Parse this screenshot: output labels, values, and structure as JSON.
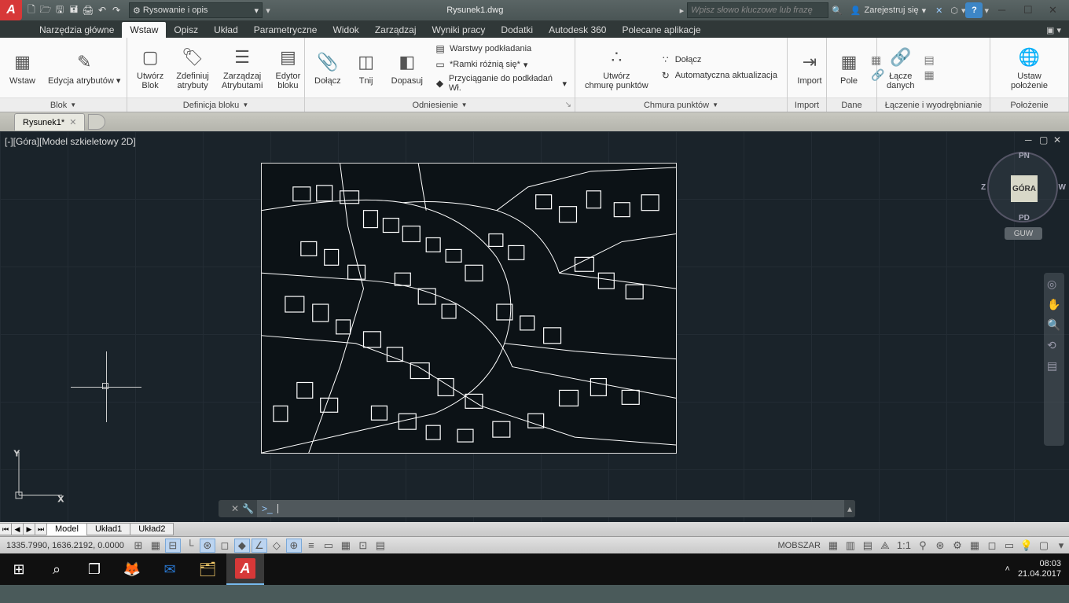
{
  "title": "Rysunek1.dwg",
  "workspace": "Rysowanie i opis",
  "search_placeholder": "Wpisz słowo kluczowe lub frazę",
  "signin": "Zarejestruj się",
  "tabs": [
    "Narzędzia główne",
    "Wstaw",
    "Opisz",
    "Układ",
    "Parametryczne",
    "Widok",
    "Zarządzaj",
    "Wyniki pracy",
    "Dodatki",
    "Autodesk 360",
    "Polecane aplikacje"
  ],
  "active_tab": 1,
  "panels": {
    "blok": {
      "title": "Blok",
      "btns": {
        "wstaw": "Wstaw",
        "edycja": "Edycja atrybutów"
      }
    },
    "defblok": {
      "title": "Definicja bloku",
      "btns": {
        "utworz": "Utwórz\nBlok",
        "zdef": "Zdefiniuj\natrybuty",
        "zarz": "Zarządzaj\nAtrybutami",
        "edytor": "Edytor\nbloku"
      }
    },
    "odniesienie": {
      "title": "Odniesienie",
      "btns": {
        "dolacz": "Dołącz",
        "tnij": "Tnij",
        "dopasuj": "Dopasuj"
      },
      "rows": {
        "warstwy": "Warstwy podkładania",
        "ramki": "*Ramki różnią się*",
        "przyc": "Przyciąganie do podkładań Wł."
      }
    },
    "chmura": {
      "title": "Chmura punktów",
      "btn": "Utwórz\nchmurę punktów",
      "rows": {
        "dolacz": "Dołącz",
        "auto": "Automatyczna aktualizacja"
      }
    },
    "import": {
      "title": "Import",
      "btn": "Import"
    },
    "dane": {
      "title": "Dane",
      "btn": "Pole"
    },
    "lacz": {
      "title": "Łączenie i wyodrębnianie",
      "btn": "Łącze\ndanych"
    },
    "poloz": {
      "title": "Położenie",
      "btn": "Ustaw\npołożenie"
    }
  },
  "filetab": "Rysunek1*",
  "view_label": "[-][Góra][Model szkieletowy 2D]",
  "viewcube": {
    "face": "GÓRA",
    "n": "PN",
    "s": "PD",
    "e": "W",
    "w": "Z",
    "guw": "GUW"
  },
  "layout_tabs": [
    "Model",
    "Układ1",
    "Układ2"
  ],
  "coords": "1335.7990, 1636.2192, 0.0000",
  "status_model": "MOBSZAR",
  "scale": "1:1",
  "cmd_prompt": ">_",
  "taskbar": {
    "time": "08:03",
    "date": "21.04.2017"
  }
}
